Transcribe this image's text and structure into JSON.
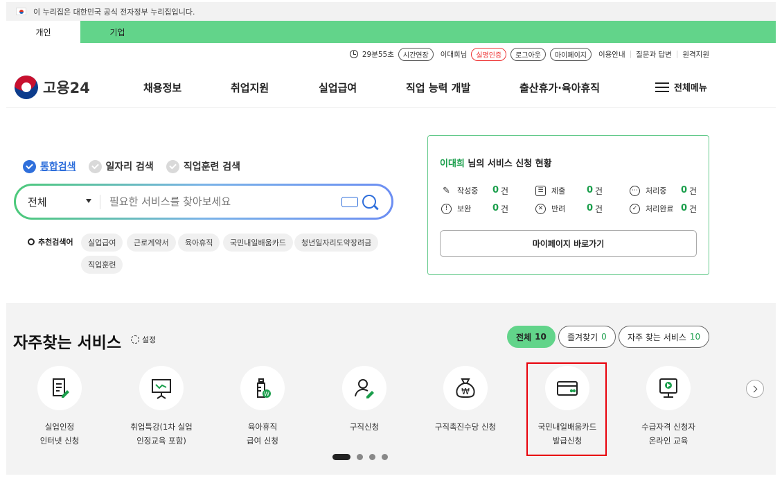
{
  "gov_banner": {
    "text": "이 누리집은 대한민국 공식 전자정부 누리집입니다."
  },
  "user_tabs": [
    {
      "label": "개인",
      "active": true
    },
    {
      "label": "기업",
      "active": false
    }
  ],
  "utility": {
    "timer": "29분55초",
    "extend_label": "시간연장",
    "user_name": "이대희님",
    "real_name_auth": "실명인증",
    "logout": "로그아웃",
    "mypage": "마이페이지",
    "links": [
      "이용안내",
      "질문과 답변",
      "원격지원"
    ]
  },
  "header": {
    "logo_text": "고용24",
    "nav": [
      "채용정보",
      "취업지원",
      "실업급여",
      "직업 능력 개발",
      "출산휴가·육아휴직"
    ],
    "all_menu": "전체메뉴"
  },
  "search": {
    "tabs": [
      {
        "label": "통합검색",
        "active": true
      },
      {
        "label": "일자리 검색",
        "active": false
      },
      {
        "label": "직업훈련 검색",
        "active": false
      }
    ],
    "category": "전체",
    "placeholder": "필요한 서비스를 찾아보세요",
    "recommend_label": "추천검색어",
    "keywords": [
      "실업급여",
      "근로계약서",
      "육아휴직",
      "국민내일배움카드",
      "청년일자리도약장려금",
      "직업훈련"
    ]
  },
  "status_panel": {
    "user": "이대희",
    "title_suffix": " 님의 서비스 신청 현황",
    "items": [
      {
        "label": "작성중",
        "count": "0",
        "unit": "건",
        "icon": "pencil-icon"
      },
      {
        "label": "제출",
        "count": "0",
        "unit": "건",
        "icon": "checklist-icon"
      },
      {
        "label": "처리중",
        "count": "0",
        "unit": "건",
        "icon": "ellipsis-icon"
      },
      {
        "label": "보완",
        "count": "0",
        "unit": "건",
        "icon": "exclamation-icon"
      },
      {
        "label": "반려",
        "count": "0",
        "unit": "건",
        "icon": "x-circle-icon"
      },
      {
        "label": "처리완료",
        "count": "0",
        "unit": "건",
        "icon": "check-circle-icon"
      }
    ],
    "mypage_button": "마이페이지 바로가기"
  },
  "services": {
    "title": "자주찾는 서비스",
    "settings": "설정",
    "filters": [
      {
        "label": "전체",
        "count": "10",
        "active": true
      },
      {
        "label": "즐겨찾기",
        "count": "0",
        "active": false
      },
      {
        "label": "자주 찾는 서비스",
        "count": "10",
        "active": false
      }
    ],
    "items": [
      {
        "label": "실업인정\n인터넷 신청",
        "icon": "document-pen-icon"
      },
      {
        "label": "취업특강(1차 실업\n인정교육 포함)",
        "icon": "presentation-board-icon"
      },
      {
        "label": "육아휴직\n급여 신청",
        "icon": "baby-bottle-icon"
      },
      {
        "label": "구직신청",
        "icon": "person-pen-icon"
      },
      {
        "label": "구직촉진수당 신청",
        "icon": "money-bag-icon"
      },
      {
        "label": "국민내일배움카드\n발급신청",
        "icon": "card-icon"
      },
      {
        "label": "수급자격 신청자\n온라인 교육",
        "icon": "monitor-play-icon"
      }
    ],
    "page_dots": 4,
    "active_page": 1
  },
  "colors": {
    "brand_green": "#62d48a",
    "count_green": "#1a9e4b",
    "search_blue": "#2f6fdb",
    "highlight_red": "#e8000a"
  }
}
